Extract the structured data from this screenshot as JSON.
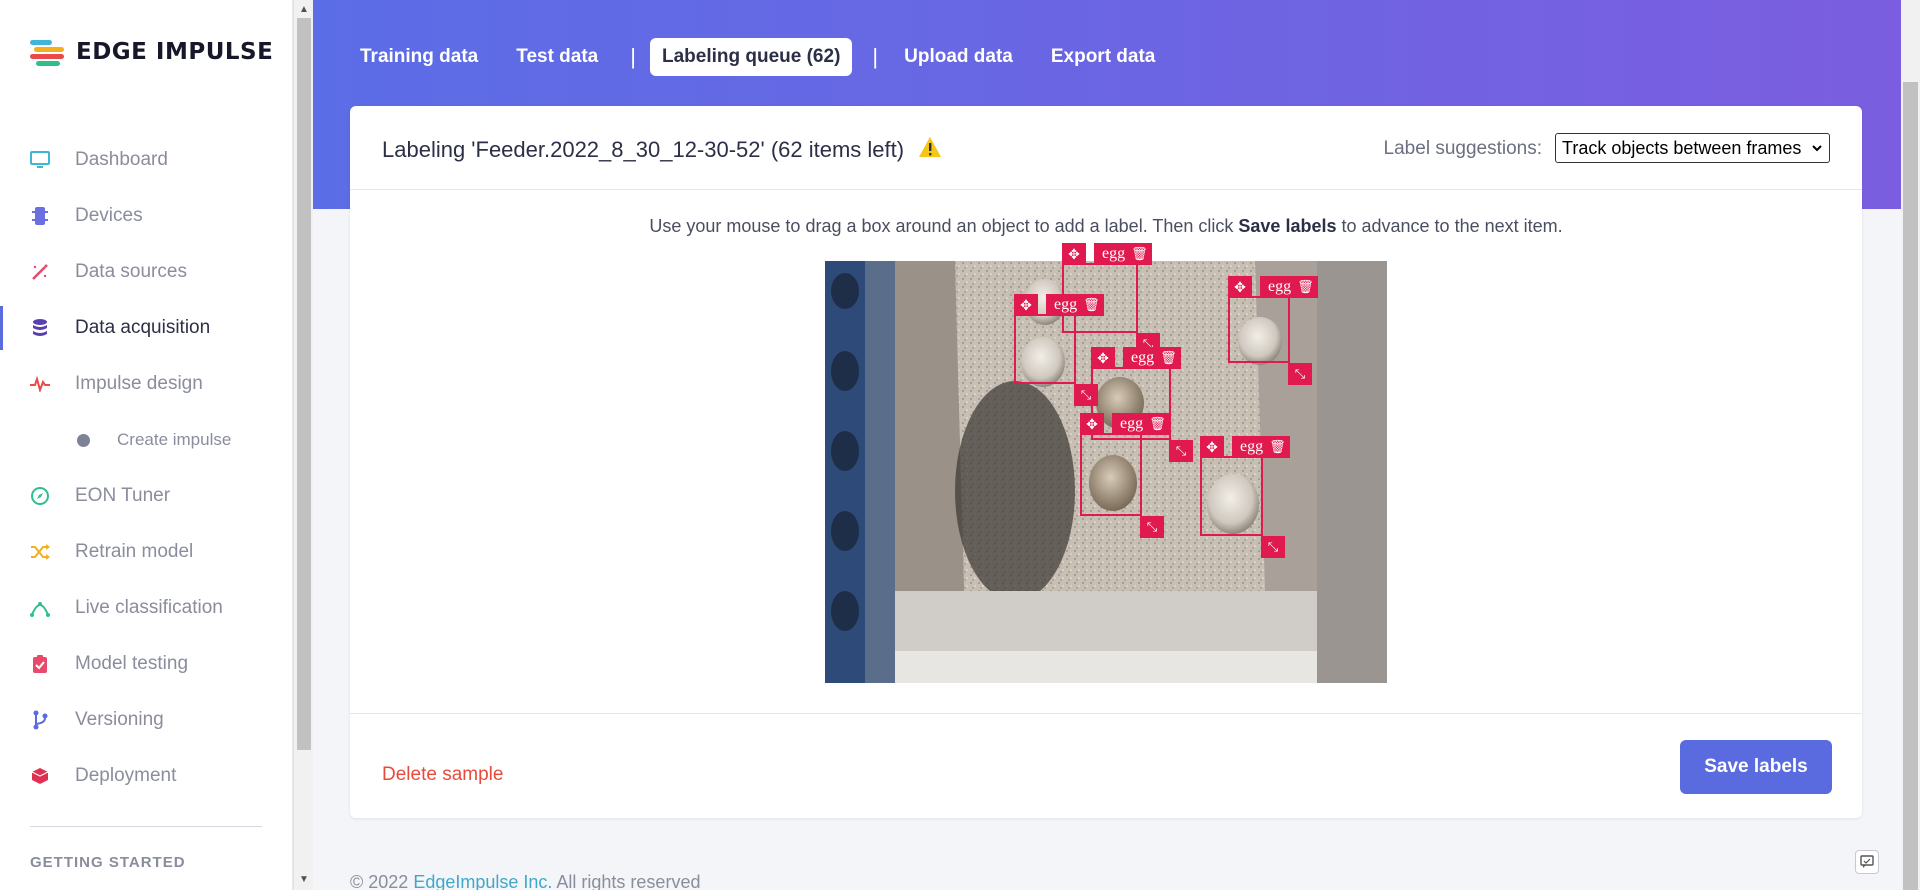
{
  "brand": {
    "name": "EDGE IMPULSE"
  },
  "sidebar": {
    "items": [
      {
        "label": "Dashboard",
        "icon": "monitor-icon",
        "color": "#3fb6d8"
      },
      {
        "label": "Devices",
        "icon": "chip-icon",
        "color": "#6b6fe0"
      },
      {
        "label": "Data sources",
        "icon": "wand-icon",
        "color": "#e84a6b"
      },
      {
        "label": "Data acquisition",
        "icon": "database-icon",
        "color": "#5a3fb0",
        "active": true
      },
      {
        "label": "Impulse design",
        "icon": "pulse-icon",
        "color": "#e84a4a"
      },
      {
        "label": "Create impulse",
        "icon": "dot-icon",
        "sub": true
      },
      {
        "label": "EON Tuner",
        "icon": "compass-icon",
        "color": "#2fbf8f"
      },
      {
        "label": "Retrain model",
        "icon": "shuffle-icon",
        "color": "#f0b020"
      },
      {
        "label": "Live classification",
        "icon": "curve-icon",
        "color": "#2fbf8f"
      },
      {
        "label": "Model testing",
        "icon": "clipboard-check-icon",
        "color": "#e84a6b"
      },
      {
        "label": "Versioning",
        "icon": "branch-icon",
        "color": "#5a6be0"
      },
      {
        "label": "Deployment",
        "icon": "cube-icon",
        "color": "#e03050"
      }
    ],
    "section_title": "GETTING STARTED"
  },
  "tabs": [
    {
      "label": "Training data"
    },
    {
      "label": "Test data"
    },
    {
      "label": "Labeling queue (62)",
      "active": true
    },
    {
      "label": "Upload data"
    },
    {
      "label": "Export data"
    }
  ],
  "labeling": {
    "title": "Labeling 'Feeder.2022_8_30_12-30-52' (62 items left)",
    "suggestions_label": "Label suggestions:",
    "suggestions_value": "Track objects between frames",
    "instruction_pre": "Use your mouse to drag a box around an object to add a label. Then click ",
    "instruction_bold": "Save labels",
    "instruction_post": " to advance to the next item.",
    "boxes": [
      {
        "label": "egg"
      },
      {
        "label": "egg"
      },
      {
        "label": "egg"
      },
      {
        "label": "egg"
      },
      {
        "label": "egg"
      },
      {
        "label": "egg"
      }
    ],
    "delete_label": "Delete sample",
    "save_label": "Save labels"
  },
  "footer": {
    "copy": "© 2022 ",
    "brand": "EdgeImpulse Inc.",
    "rest": " All rights reserved"
  },
  "colors": {
    "accent": "#5a6be0",
    "box": "#e0194f",
    "danger": "#e84a3b",
    "warning": "#f5c518"
  }
}
